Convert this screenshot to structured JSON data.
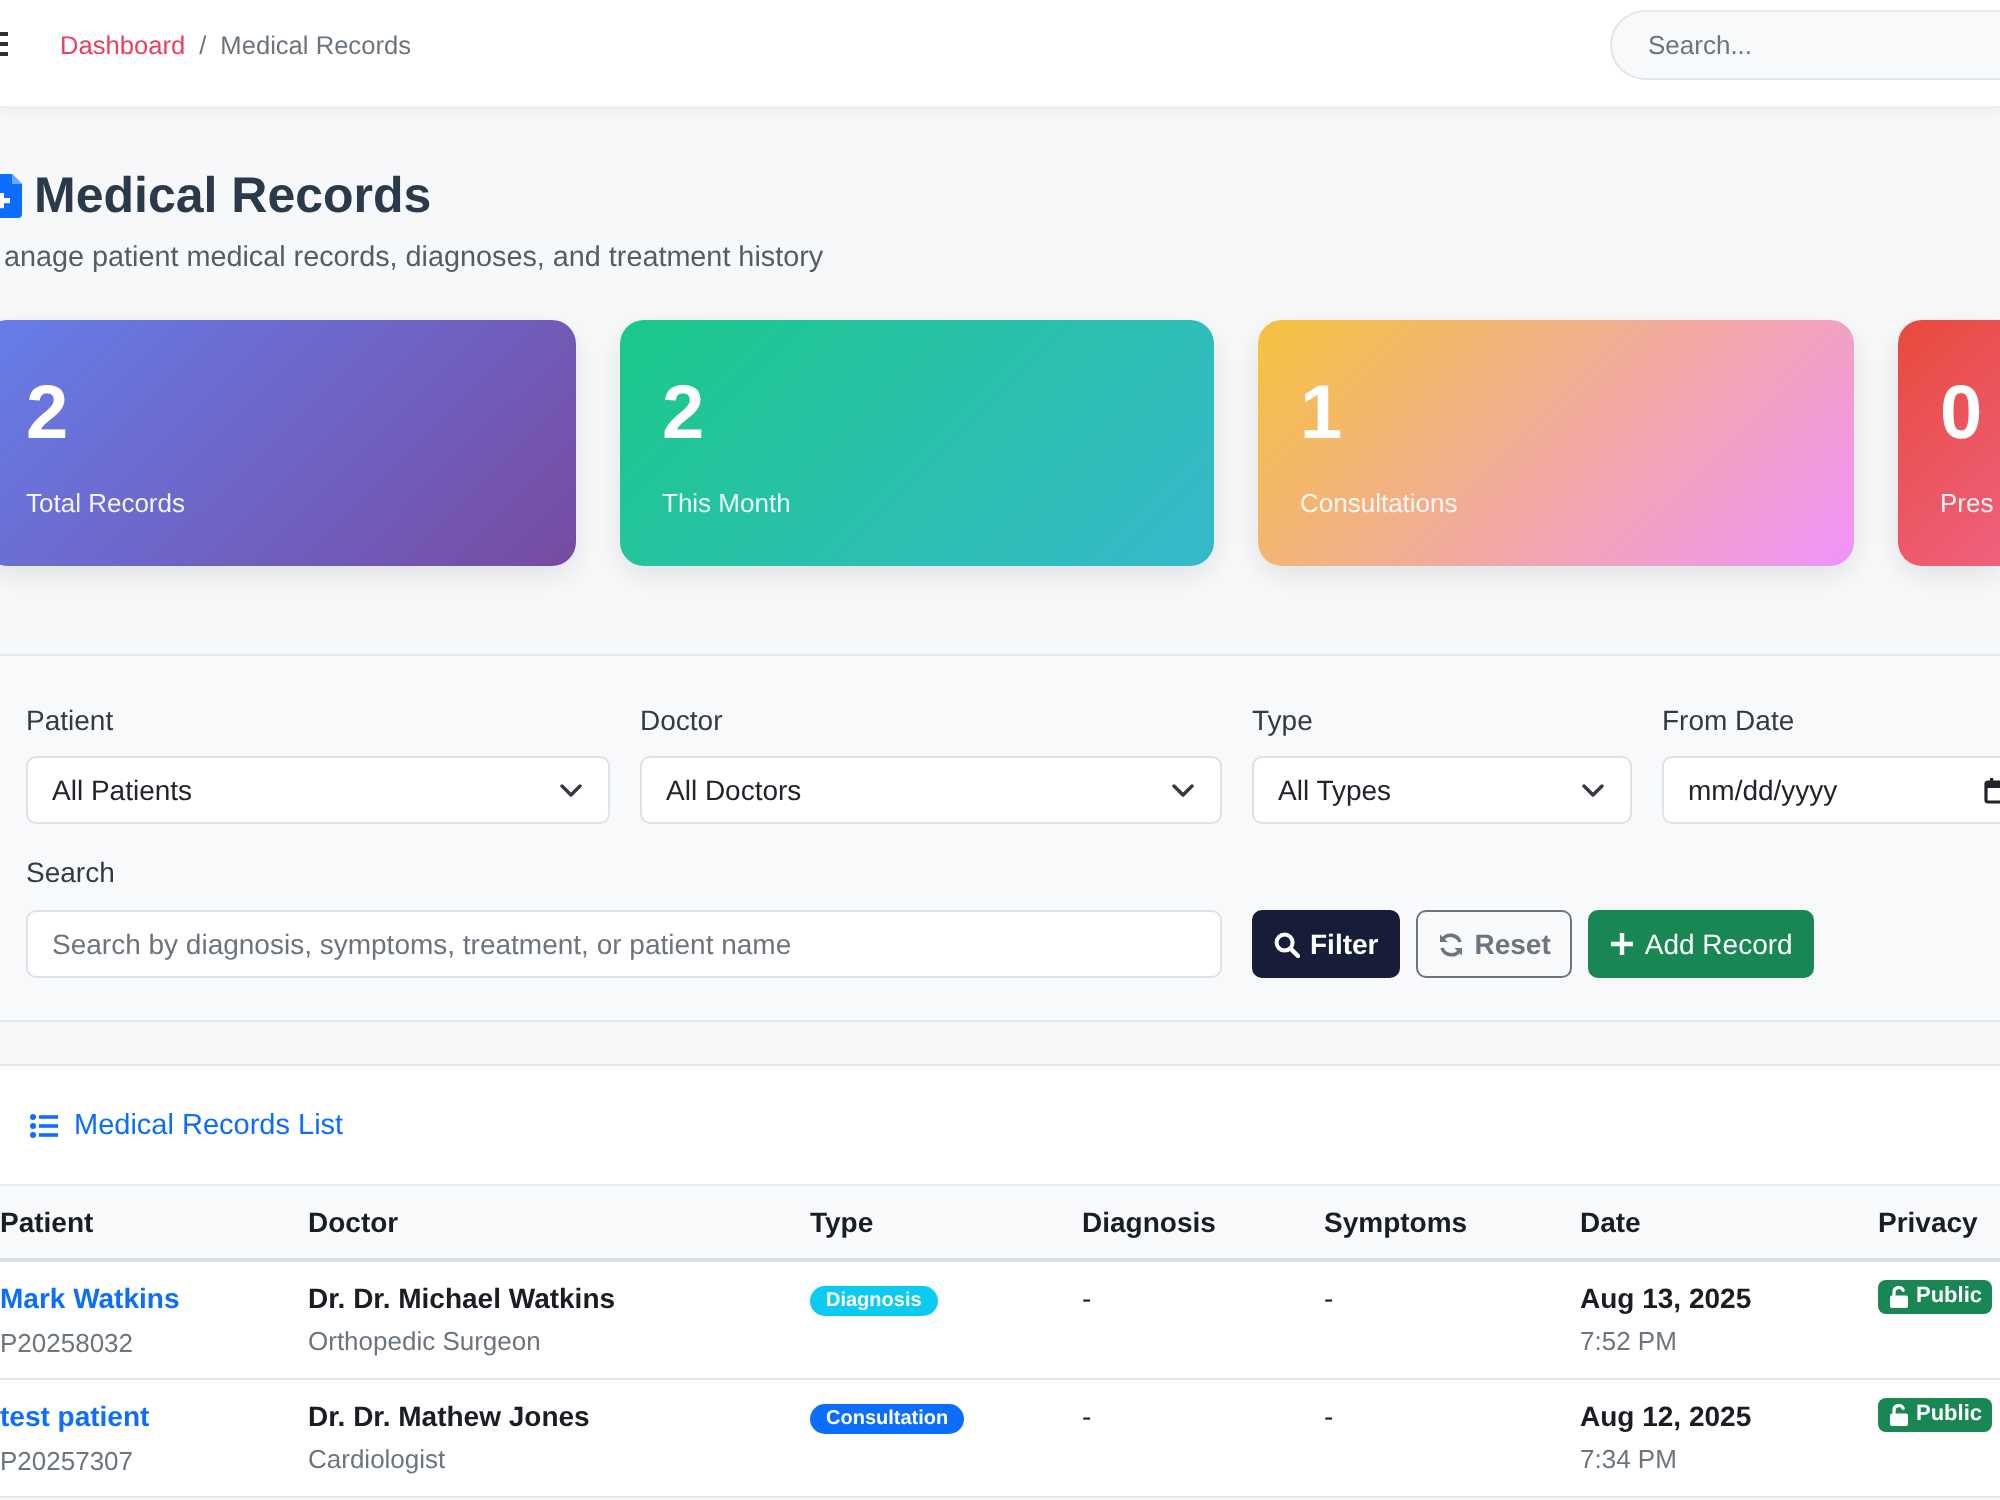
{
  "header": {
    "breadcrumb": [
      {
        "label": "Dashboard",
        "kind": "link"
      },
      {
        "label": "Medical Records",
        "kind": "current"
      }
    ],
    "separator": "/",
    "search": {
      "placeholder": "Search..."
    }
  },
  "page": {
    "title": "Medical Records",
    "subtitle": "anage patient medical records, diagnoses, and treatment history"
  },
  "stats": [
    {
      "value": "2",
      "label": "Total Records",
      "color": "#667eea"
    },
    {
      "value": "2",
      "label": "This Month",
      "color": "#1cc88a"
    },
    {
      "value": "1",
      "label": "Consultations",
      "color": "#f6c23e"
    },
    {
      "value": "0",
      "label": "Pres",
      "color": "#e74a3b"
    }
  ],
  "filters": {
    "fields": [
      {
        "label": "Patient",
        "kind": "select",
        "value": "All Patients"
      },
      {
        "label": "Doctor",
        "kind": "select",
        "value": "All Doctors"
      },
      {
        "label": "Type",
        "kind": "select",
        "value": "All Types"
      },
      {
        "label": "From Date",
        "kind": "date",
        "value": "mm/dd/yyyy"
      }
    ],
    "search": {
      "label": "Search",
      "placeholder": "Search by diagnosis, symptoms, treatment, or patient name"
    },
    "buttons": [
      {
        "label": "Filter",
        "kind": "filter"
      },
      {
        "label": "Reset",
        "kind": "reset"
      },
      {
        "label": "Add Record",
        "kind": "add"
      }
    ]
  },
  "records": {
    "title": "Medical Records List",
    "columns": [
      "Patient",
      "Doctor",
      "Type",
      "Diagnosis",
      "Symptoms",
      "Date",
      "Privacy"
    ],
    "rows": [
      {
        "patient": {
          "name": "Mark Watkins",
          "id": "P20258032"
        },
        "doctor": {
          "name": "Dr. Dr. Michael Watkins",
          "specialty": "Orthopedic Surgeon"
        },
        "type": {
          "label": "Diagnosis",
          "color": "#0dcaf0"
        },
        "diagnosis": "-",
        "symptoms": "-",
        "date": "Aug 13, 2025",
        "time": "7:52 PM",
        "privacy": "Public"
      },
      {
        "patient": {
          "name": "test patient",
          "id": "P20257307"
        },
        "doctor": {
          "name": "Dr. Dr. Mathew Jones",
          "specialty": "Cardiologist"
        },
        "type": {
          "label": "Consultation",
          "color": "#0d6efd"
        },
        "diagnosis": "-",
        "symptoms": "-",
        "date": "Aug 12, 2025",
        "time": "7:34 PM",
        "privacy": "Public"
      }
    ]
  }
}
